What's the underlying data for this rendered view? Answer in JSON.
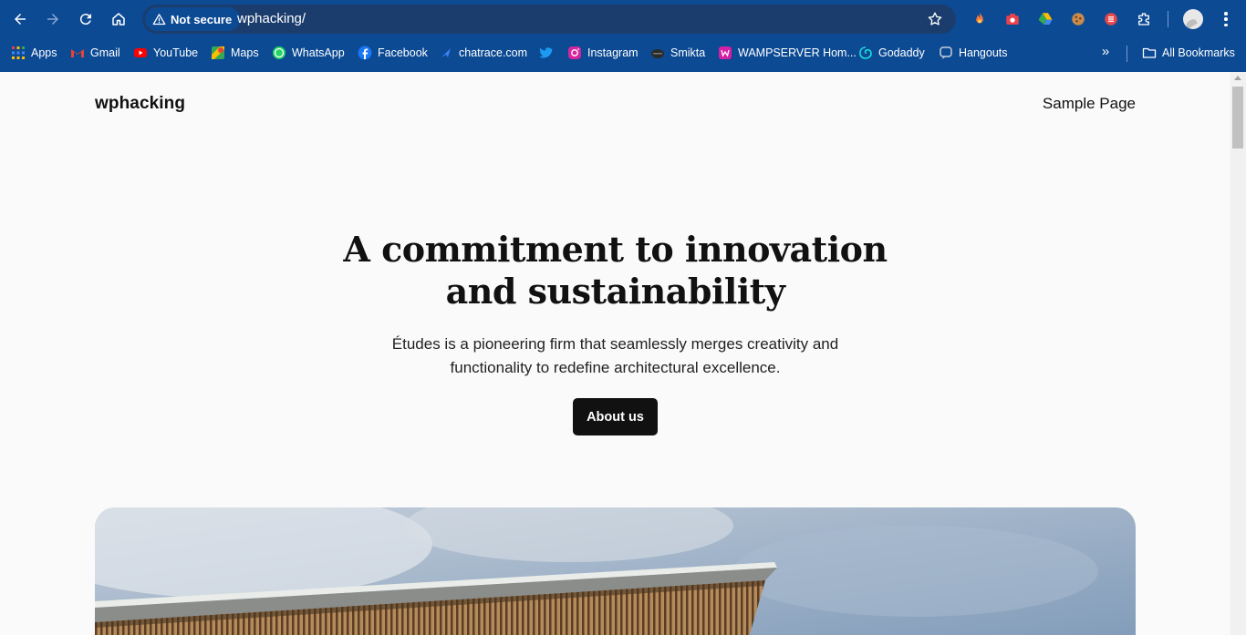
{
  "browser": {
    "security_label": "Not secure",
    "url": "wphacking/",
    "bookmarks": [
      {
        "label": "Apps",
        "icon": "apps-grid-icon"
      },
      {
        "label": "Gmail",
        "icon": "gmail-icon"
      },
      {
        "label": "YouTube",
        "icon": "youtube-icon"
      },
      {
        "label": "Maps",
        "icon": "maps-icon"
      },
      {
        "label": "WhatsApp",
        "icon": "whatsapp-icon"
      },
      {
        "label": "Facebook",
        "icon": "facebook-icon"
      },
      {
        "label": "chatrace.com",
        "icon": "chatrace-icon"
      },
      {
        "label": "",
        "icon": "twitter-icon"
      },
      {
        "label": "Instagram",
        "icon": "instagram-icon"
      },
      {
        "label": "Smikta",
        "icon": "smikta-icon"
      },
      {
        "label": "WAMPSERVER Hom...",
        "icon": "wampserver-icon"
      },
      {
        "label": "Godaddy",
        "icon": "godaddy-icon"
      },
      {
        "label": "Hangouts",
        "icon": "hangouts-icon"
      }
    ],
    "all_bookmarks_label": "All Bookmarks",
    "colors": {
      "chrome": "#0c4a94",
      "omnibox": "#1b3d6d"
    }
  },
  "site": {
    "title": "wphacking",
    "nav_item": "Sample Page",
    "hero": {
      "title_line1": "A commitment to innovation",
      "title_line2": "and sustainability",
      "subtitle_line1": "Études is a pioneering firm that seamlessly merges creativity and",
      "subtitle_line2": "functionality to redefine architectural excellence.",
      "button_label": "About us"
    }
  }
}
